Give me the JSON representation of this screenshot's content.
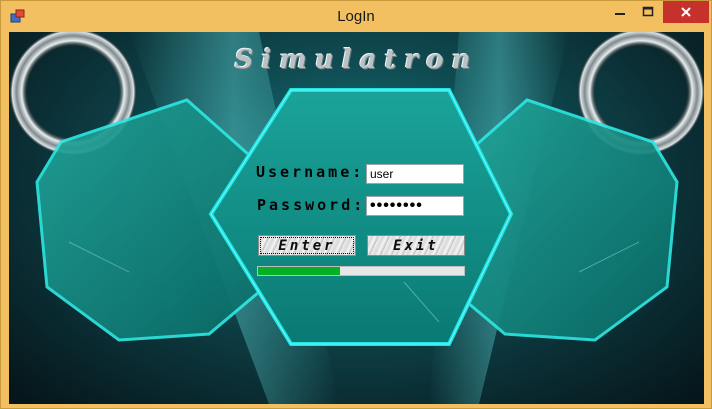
{
  "window": {
    "title": "LogIn",
    "controls": {
      "minimize_icon": "minimize-icon",
      "maximize_icon": "maximize-icon",
      "close_icon": "close-icon"
    }
  },
  "banner": {
    "title": "Simulatron"
  },
  "form": {
    "username_label": "Username:",
    "username_value": "user",
    "password_label": "Password:",
    "password_value": "••••••••",
    "enter_label": "Enter",
    "exit_label": "Exit"
  },
  "progress": {
    "value": 0.4,
    "color": "#06b025"
  },
  "colors": {
    "accent_cyan": "#19e6e6",
    "panel_teal": "#0f8c84",
    "title_bar": "#f2c060",
    "close_red": "#c7312b"
  }
}
